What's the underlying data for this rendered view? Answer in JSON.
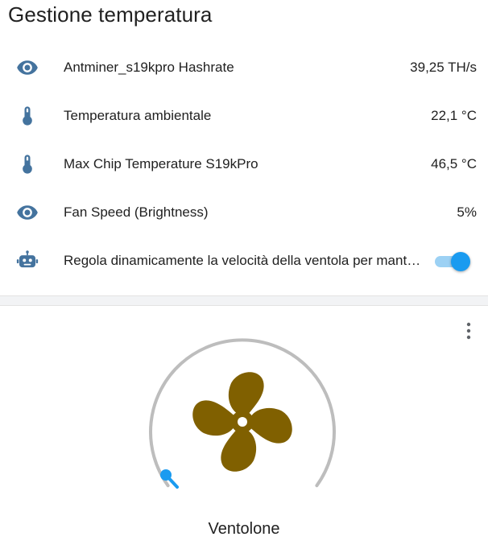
{
  "card": {
    "title": "Gestione temperatura",
    "rows": [
      {
        "icon": "eye-icon",
        "label": "Antminer_s19kpro Hashrate",
        "value": "39,25 TH/s"
      },
      {
        "icon": "thermometer-icon",
        "label": "Temperatura ambientale",
        "value": "22,1 °C"
      },
      {
        "icon": "thermometer-icon",
        "label": "Max Chip Temperature S19kPro",
        "value": "46,5 °C"
      },
      {
        "icon": "eye-icon",
        "label": "Fan Speed (Brightness)",
        "value": "5%"
      },
      {
        "icon": "robot-icon",
        "label": "Regola dinamicamente la velocità della ventola per mantenere la temperatura",
        "toggle_on": true
      }
    ]
  },
  "fan_card": {
    "name": "Ventolone",
    "speed_percent": 5,
    "state": "on"
  },
  "colors": {
    "icon": "#44739e",
    "accent": "#1a9bf0",
    "fan": "#806000",
    "dial_track": "#bdbdbd"
  }
}
